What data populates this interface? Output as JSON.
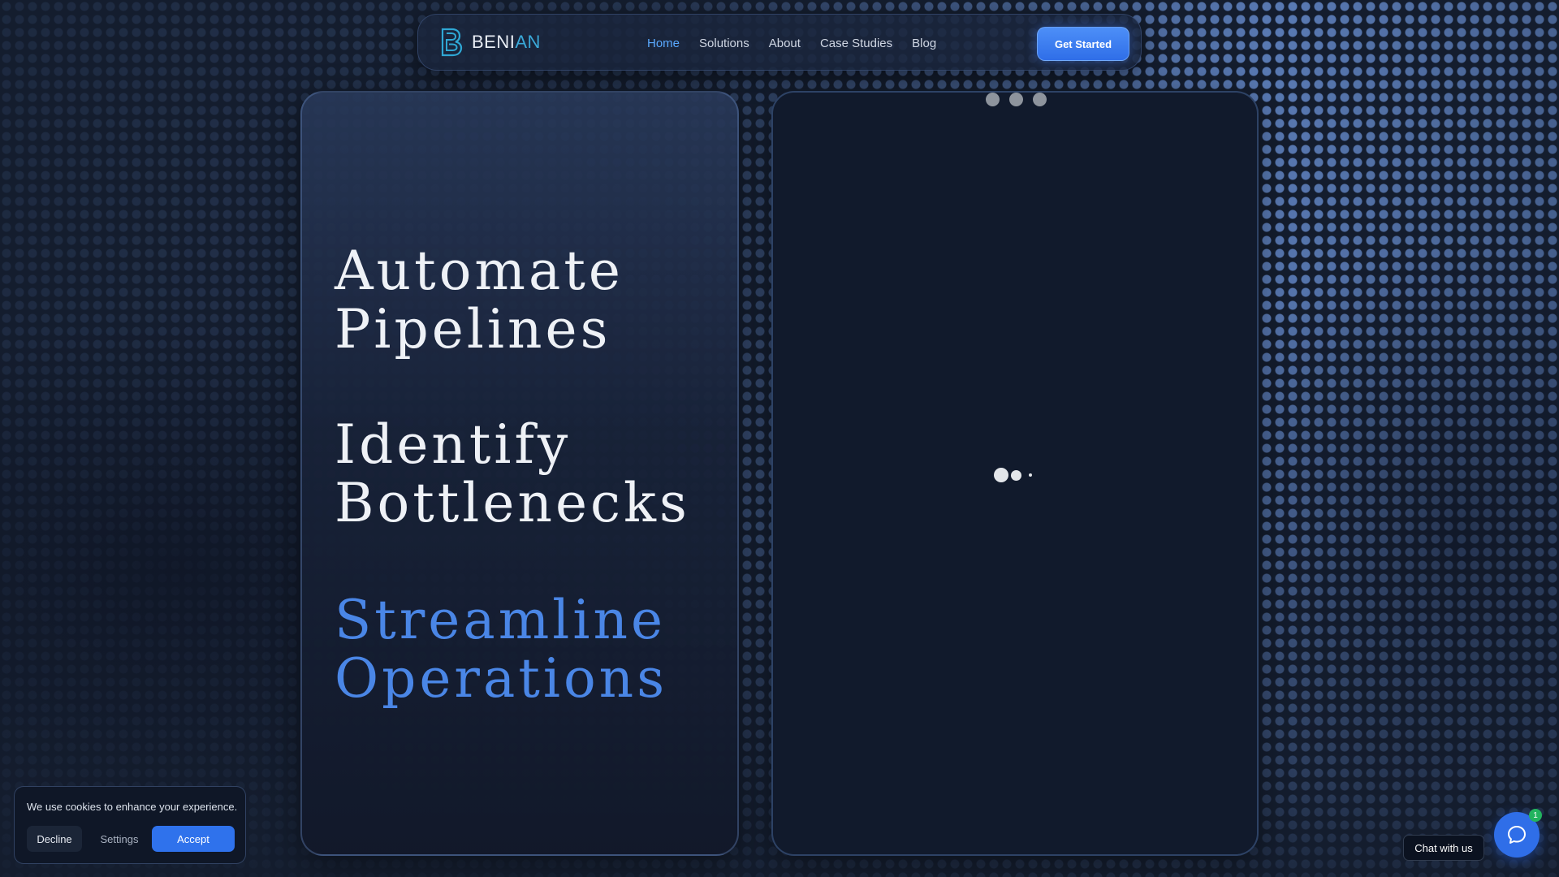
{
  "nav": {
    "logo": {
      "text_main": "BENI",
      "text_accent": "AN",
      "icon": "b-logo-icon"
    },
    "links": [
      {
        "label": "Home",
        "active": true
      },
      {
        "label": "Solutions",
        "active": false
      },
      {
        "label": "About",
        "active": false
      },
      {
        "label": "Case Studies",
        "active": false
      },
      {
        "label": "Blog",
        "active": false
      }
    ],
    "cta_label": "Get Started"
  },
  "hero": {
    "headlines": [
      {
        "line1": "Automate",
        "line2": "Pipelines"
      },
      {
        "line1": "Identify",
        "line2": "Bottlenecks"
      },
      {
        "line1": "Streamline",
        "line2": "Operations"
      }
    ]
  },
  "cookie_banner": {
    "message": "We use cookies to enhance your experience.",
    "decline_label": "Decline",
    "settings_label": "Settings",
    "accept_label": "Accept"
  },
  "chat": {
    "label": "Chat with us",
    "badge_count": "1",
    "icon": "chat-bubble-icon"
  },
  "colors": {
    "accent": "#2f6ee8",
    "headline_accent": "#4a86e6",
    "nav_active": "#5aa9ff",
    "background": "#141d2e"
  }
}
